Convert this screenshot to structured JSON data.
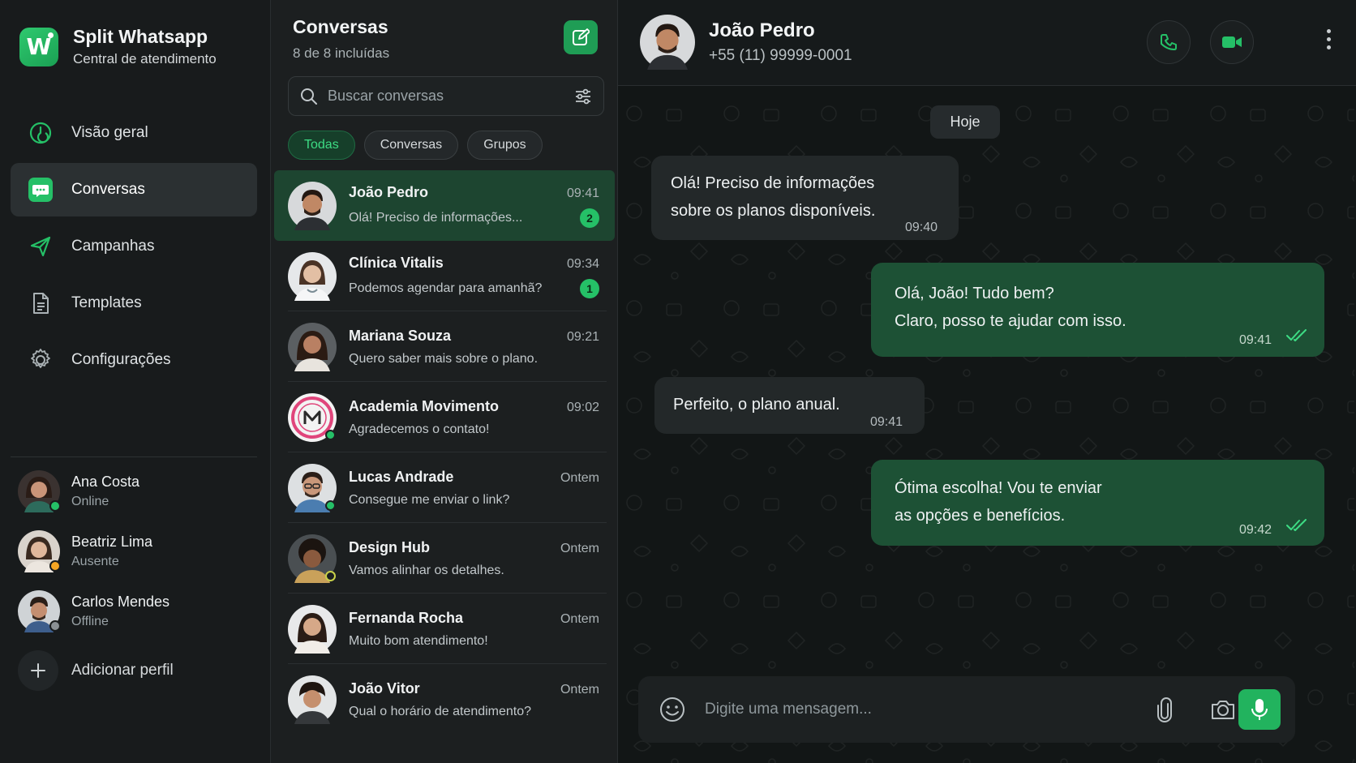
{
  "brand": {
    "title": "Split Whatsapp",
    "subtitle": "Central de atendimento",
    "logo_letter": "W"
  },
  "nav": [
    {
      "label": "Visão geral",
      "icon": "dashboard-icon"
    },
    {
      "label": "Conversas",
      "icon": "chat-icon",
      "active": true
    },
    {
      "label": "Campanhas",
      "icon": "send-icon"
    },
    {
      "label": "Templates",
      "icon": "document-icon"
    },
    {
      "label": "Configurações",
      "icon": "gear-icon"
    }
  ],
  "profiles": [
    {
      "name": "Ana Costa",
      "status": "Online",
      "status_color": "#25c067"
    },
    {
      "name": "Beatriz Lima",
      "status": "Ausente",
      "status_color": "#f5a524"
    },
    {
      "name": "Carlos Mendes",
      "status": "Offline",
      "status_color": "#8a9094"
    }
  ],
  "add_profile_label": "Adicionar perfil",
  "conversations_panel": {
    "title": "Conversas",
    "count": "8 de 8 incluídas",
    "search_placeholder": "Buscar conversas",
    "filters": [
      "Todas",
      "Conversas",
      "Grupos"
    ],
    "active_filter": "Todas"
  },
  "conversations": [
    {
      "name": "João Pedro",
      "time": "09:41",
      "preview": "Olá! Preciso de informações...",
      "unread": "2",
      "active": true
    },
    {
      "name": "Clínica Vitalis",
      "time": "09:34",
      "preview": "Podemos agendar para amanhã?",
      "unread": "1"
    },
    {
      "name": "Mariana Souza",
      "time": "09:21",
      "preview": "Quero saber mais sobre o plano."
    },
    {
      "name": "Academia Movimento",
      "time": "09:02",
      "preview": "Agradecemos o contato!",
      "online": true
    },
    {
      "name": "Lucas Andrade",
      "time": "Ontem",
      "preview": "Consegue me enviar o link?",
      "online": true
    },
    {
      "name": "Design Hub",
      "time": "Ontem",
      "preview": "Vamos alinhar os detalhes.",
      "away": true
    },
    {
      "name": "Fernanda Rocha",
      "time": "Ontem",
      "preview": "Muito bom atendimento!"
    },
    {
      "name": "João Vitor",
      "time": "Ontem",
      "preview": "Qual o horário de atendimento?"
    }
  ],
  "chat": {
    "contact_name": "João Pedro",
    "contact_phone": "+55 (11) 99999-0001",
    "day_label": "Hoje",
    "messages": [
      {
        "direction": "in",
        "lines": [
          "Olá! Preciso de informações",
          "sobre os planos disponíveis."
        ],
        "time": "09:40"
      },
      {
        "direction": "out",
        "lines": [
          "Olá, João! Tudo bem?",
          "Claro, posso te ajudar com isso."
        ],
        "time": "09:41",
        "read": true
      },
      {
        "direction": "in",
        "lines": [
          "Perfeito, o plano anual."
        ],
        "time": "09:41"
      },
      {
        "direction": "out",
        "lines": [
          "Ótima escolha! Vou te enviar",
          "as opções e benefícios."
        ],
        "time": "09:42",
        "read": true
      }
    ],
    "composer_placeholder": "Digite uma mensagem..."
  },
  "colors": {
    "accent": "#25c067",
    "outgoing_bubble": "#1d5135",
    "incoming_bubble": "#232829"
  }
}
